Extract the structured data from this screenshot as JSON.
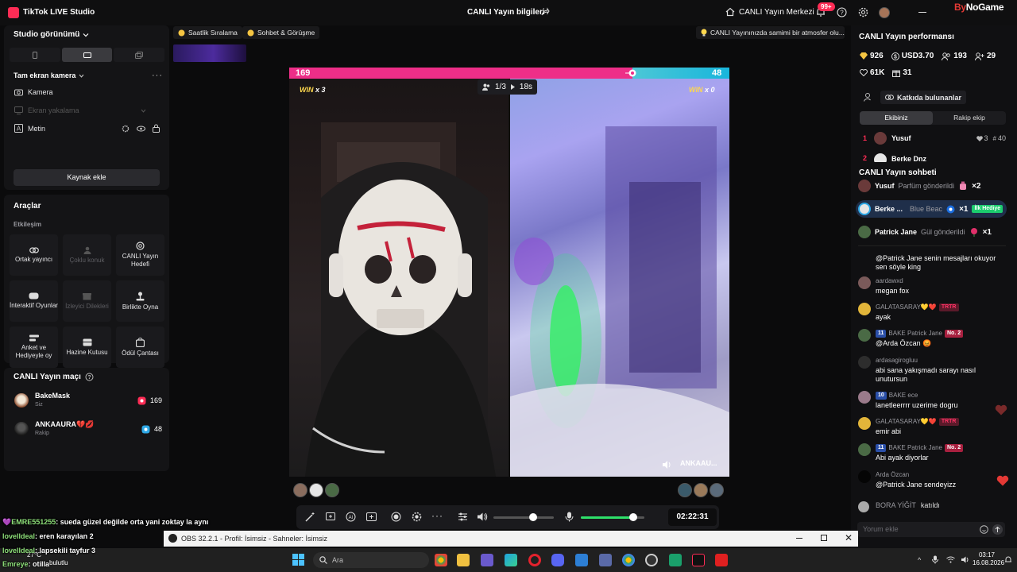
{
  "titlebar": {
    "app_name": "TikTok LIVE Studio",
    "center_title": "CANLI Yayın bilgileri",
    "live_center": "CANLI Yayın Merkezi",
    "notif_count": "99+",
    "watermark_a": "By",
    "watermark_b": "NoGame"
  },
  "left": {
    "studio_view": "Studio görünümü",
    "scene_title": "Tam ekran kamera",
    "sources": [
      {
        "label": "Kamera",
        "icon": "camera-icon"
      },
      {
        "label": "Ekran yakalama",
        "icon": "monitor-icon"
      },
      {
        "label": "Metin",
        "icon": "text-icon"
      }
    ],
    "add_source": "Kaynak ekle",
    "tools_title": "Araçlar",
    "tools_sub": "Etkileşim",
    "tools": [
      {
        "label": "Ortak yayıncı",
        "icon": "link-icon"
      },
      {
        "label": "Çoklu konuk",
        "icon": "group-icon"
      },
      {
        "label": "CANLI Yayın Hedefi",
        "icon": "target-icon"
      },
      {
        "label": "İnteraktif Oyunlar",
        "icon": "gamepad-icon"
      },
      {
        "label": "İzleyici Dilekleri",
        "icon": "gift-icon"
      },
      {
        "label": "Birlikte Oyna",
        "icon": "joystick-icon"
      },
      {
        "label": "Anket ve Hediyeyle oy",
        "icon": "poll-icon"
      },
      {
        "label": "Hazine Kutusu",
        "icon": "chest-icon"
      },
      {
        "label": "Ödül Çantası",
        "icon": "bag-icon"
      }
    ],
    "match_title": "CANLI Yayın maçı",
    "match": [
      {
        "name": "BakeMask",
        "role": "Siz",
        "score": "169",
        "color": "#fe2c55"
      },
      {
        "name": "ANKAAURA💔💋",
        "role": "Rakip",
        "score": "48",
        "color": "#2ea8e6"
      }
    ]
  },
  "top": {
    "chip1": "Saatlik Sıralama",
    "chip2": "Sohbet & Görüşme",
    "chip3": "CANLI Yayınınızda samimi bir atmosfer olu..."
  },
  "battle": {
    "score_left": "169",
    "score_right": "48",
    "win_left_a": "WIN",
    "win_left_b": "x 3",
    "win_right_a": "WIN",
    "win_right_b": "x 0",
    "round": "1/3",
    "time_left": "18s",
    "opponent": "ANKAAU...",
    "left_share": 0.78
  },
  "controls": {
    "clock": "02:22:31",
    "volume": 0.66,
    "mic": 0.82
  },
  "right": {
    "perf_title": "CANLI Yayın performansı",
    "stats": [
      {
        "icon": "diamond-icon",
        "value": "926"
      },
      {
        "icon": "dollar-icon",
        "value": "USD3.70"
      },
      {
        "icon": "people-icon",
        "value": "193"
      },
      {
        "icon": "user-add-icon",
        "value": "29"
      },
      {
        "icon": "heart-icon",
        "value": "61K"
      },
      {
        "icon": "gift-icon",
        "value": "31"
      }
    ],
    "contributors": "Katkıda bulunanlar",
    "tab_ours": "Ekibiniz",
    "tab_rival": "Rakip ekip",
    "rank": [
      {
        "n": "1",
        "name": "Yusuf",
        "hearts": "3",
        "gifts": "40"
      },
      {
        "n": "2",
        "name": "Berke Dnz"
      }
    ],
    "chat_title": "CANLI Yayın sohbeti",
    "gifts": [
      {
        "name": "Yusuf",
        "text": "Parfüm gönderildi",
        "count": "×2"
      },
      {
        "name": "Berke ...",
        "text": "Blue Beac",
        "count": "×1",
        "tag": "İlk Hediye"
      },
      {
        "name": "Patrick Jane",
        "text": "Gül gönderildi",
        "count": "×1"
      }
    ],
    "messages": [
      {
        "user": "",
        "text": "@Patrick Jane senin mesajları okuyor sen söyle king"
      },
      {
        "user": "aardawxd",
        "text": "megan fox"
      },
      {
        "user": "GALATASARAY💛❤️",
        "text": "ayak"
      },
      {
        "user": "BAKE Patrick Jane",
        "lvl": "11",
        "rank": "No. 2",
        "text": "@Arda Özcan 😡"
      },
      {
        "user": "ardasagirogluu",
        "text": "abi sana yakışmadı sarayı nasıl unutursun"
      },
      {
        "user": "BAKE ece",
        "lvl": "10",
        "text": "lanetleerrrr uzerime dogru"
      },
      {
        "user": "GALATASARAY💛❤️",
        "text": "emir abi"
      },
      {
        "user": "BAKE Patrick Jane",
        "lvl": "11",
        "rank": "No. 2",
        "text": "Abi ayak diyorlar"
      },
      {
        "user": "Arda Özcan",
        "text": "@Patrick Jane sendeyizz"
      },
      {
        "user": "BORA YİĞİT",
        "text": "katıldı"
      }
    ],
    "chat_placeholder": "Yorum ekle"
  },
  "overlay": [
    {
      "user": "EMRE551255",
      "text": "sueda güzel değilde orta yani zoktay la aynı"
    },
    {
      "user": "lovelldeal",
      "text": "eren karayılan 2"
    },
    {
      "user": "lovelldeal",
      "text": "lapsekili tayfur 3"
    },
    {
      "user": "Emreye",
      "text": "otilla"
    }
  ],
  "obs": {
    "title": "OBS 32.2.1 - Profil: İsimsiz - Sahneler: İsimsiz"
  },
  "taskbar": {
    "weather": "27°C",
    "weather_sub": "bulutlu",
    "search": "Ara",
    "time": "03:17",
    "date": "16.08.2026"
  }
}
